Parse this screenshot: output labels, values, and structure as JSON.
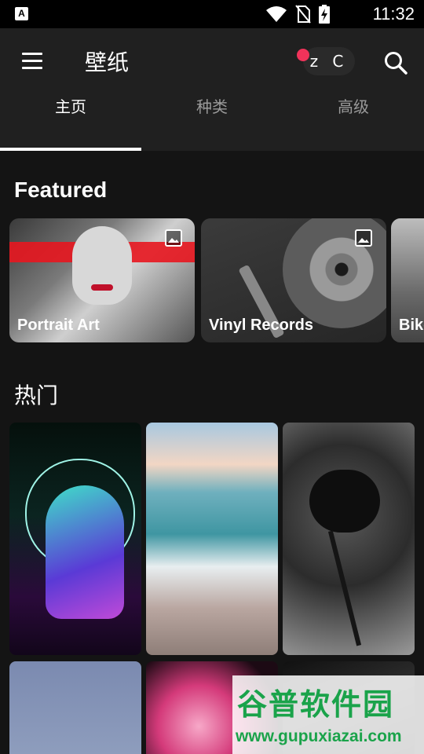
{
  "status_bar": {
    "time": "11:32",
    "app_icon_letter": "A"
  },
  "app_bar": {
    "title": "壁纸",
    "avatar_text": "z C"
  },
  "tabs": [
    {
      "label": "主页",
      "active": true
    },
    {
      "label": "种类",
      "active": false
    },
    {
      "label": "高级",
      "active": false
    }
  ],
  "featured": {
    "title": "Featured",
    "cards": [
      {
        "label": "Portrait Art"
      },
      {
        "label": "Vinyl Records"
      },
      {
        "label": "Bike"
      }
    ]
  },
  "popular": {
    "title": "热门"
  },
  "watermark": {
    "title": "谷普软件园",
    "url": "www.gupuxiazai.com"
  },
  "colors": {
    "background": "#141414",
    "appbar": "#202020",
    "notification": "#f0335a"
  }
}
